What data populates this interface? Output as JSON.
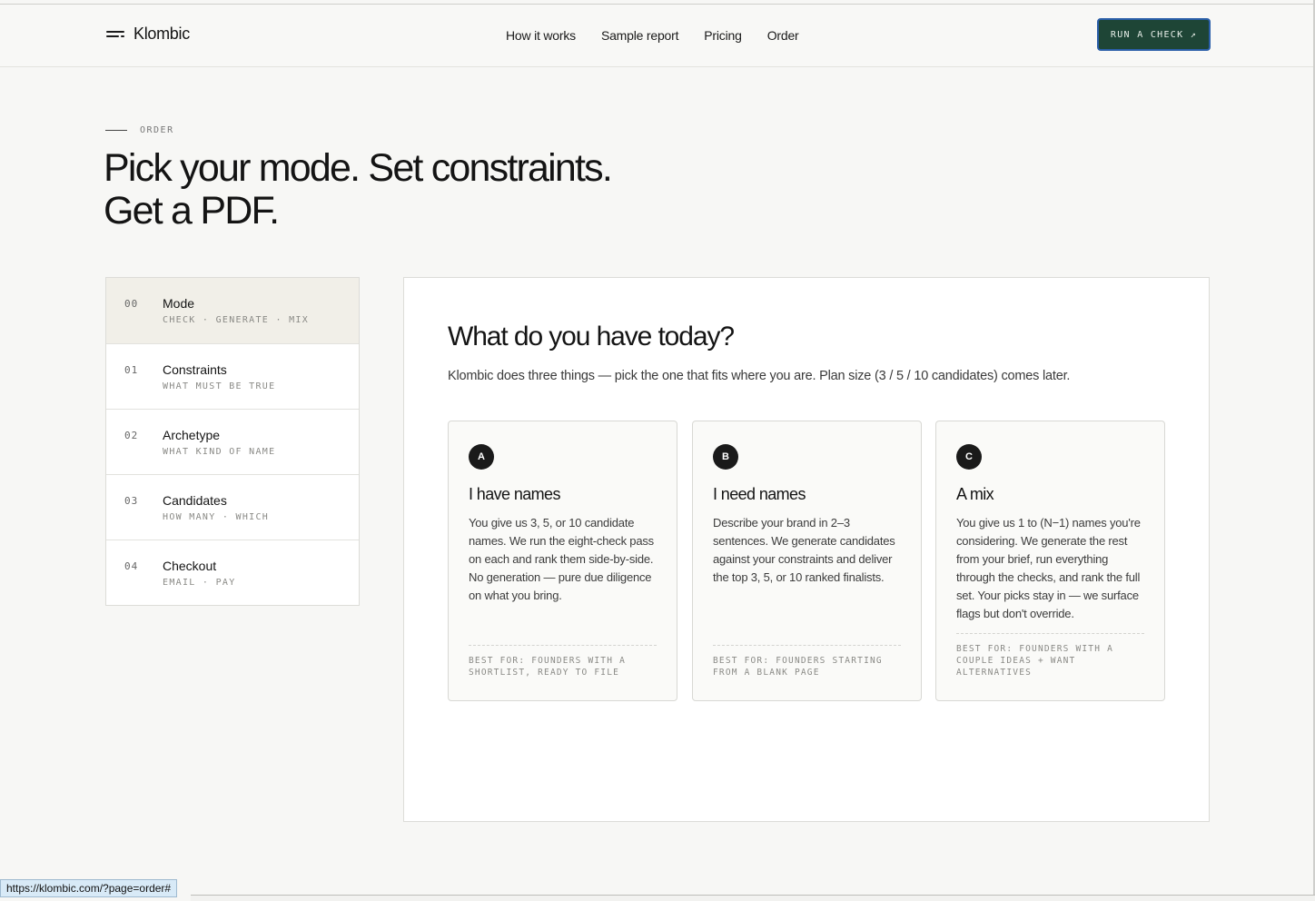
{
  "header": {
    "brand": "Klombic",
    "nav": [
      "How it works",
      "Sample report",
      "Pricing",
      "Order"
    ],
    "cta_label": "RUN A CHECK ↗"
  },
  "page": {
    "eyebrow": "ORDER",
    "headline_line1": "Pick your mode. Set constraints.",
    "headline_line2": "Get a PDF."
  },
  "steps": [
    {
      "num": "00",
      "title": "Mode",
      "sub": "CHECK · GENERATE · MIX",
      "active": true
    },
    {
      "num": "01",
      "title": "Constraints",
      "sub": "WHAT MUST BE TRUE",
      "active": false
    },
    {
      "num": "02",
      "title": "Archetype",
      "sub": "WHAT KIND OF NAME",
      "active": false
    },
    {
      "num": "03",
      "title": "Candidates",
      "sub": "HOW MANY · WHICH",
      "active": false
    },
    {
      "num": "04",
      "title": "Checkout",
      "sub": "EMAIL · PAY",
      "active": false
    }
  ],
  "panel": {
    "title": "What do you have today?",
    "lead": "Klombic does three things — pick the one that fits where you are. Plan size (3 / 5 / 10 candidates) comes later.",
    "cards": [
      {
        "badge": "A",
        "title": "I have names",
        "body": "You give us 3, 5, or 10 candidate names. We run the eight-check pass on each and rank them side-by-side. No generation — pure due diligence on what you bring.",
        "foot": "BEST FOR: FOUNDERS WITH A SHORTLIST, READY TO FILE"
      },
      {
        "badge": "B",
        "title": "I need names",
        "body": "Describe your brand in 2–3 sentences. We generate candidates against your constraints and deliver the top 3, 5, or 10 ranked finalists.",
        "foot": "BEST FOR: FOUNDERS STARTING FROM A BLANK PAGE"
      },
      {
        "badge": "C",
        "title": "A mix",
        "body": "You give us 1 to (N−1) names you're considering. We generate the rest from your brief, run everything through the checks, and rank the full set. Your picks stay in — we surface flags but don't override.",
        "foot": "BEST FOR: FOUNDERS WITH A COUPLE IDEAS + WANT ALTERNATIVES"
      }
    ]
  },
  "status_url": "https://klombic.com/?page=order#"
}
